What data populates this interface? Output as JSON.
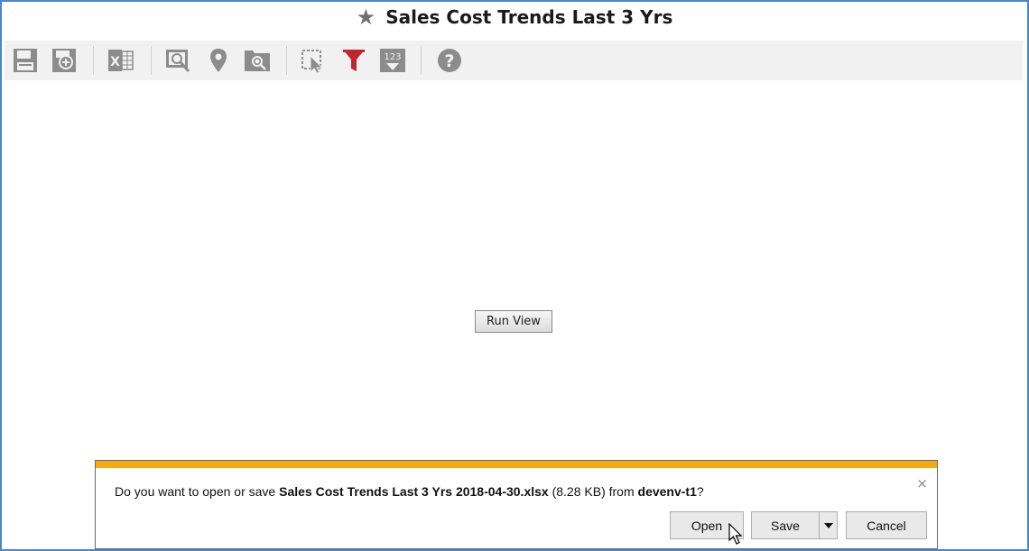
{
  "header": {
    "title": "Sales Cost Trends Last 3 Yrs",
    "favorite_icon": "star-icon"
  },
  "toolbar": {
    "items": [
      {
        "name": "save-icon"
      },
      {
        "name": "save-as-icon"
      },
      {
        "name": "export-excel-icon"
      },
      {
        "name": "analyze-icon"
      },
      {
        "name": "map-pin-icon"
      },
      {
        "name": "zoom-report-icon"
      },
      {
        "name": "select-cursor-icon"
      },
      {
        "name": "filter-icon",
        "color": "#c0262d"
      },
      {
        "name": "number-format-icon"
      },
      {
        "name": "help-icon"
      }
    ],
    "icon_color": "#8c8c8c"
  },
  "main": {
    "run_view_label": "Run View"
  },
  "download_bar": {
    "accent_color": "#f4a915",
    "msg_prefix": "Do you want to open or save ",
    "file_name": "Sales Cost Trends Last 3 Yrs 2018-04-30.xlsx",
    "file_size": "(8.28 KB)",
    "msg_from": " from ",
    "host": "devenv-t1",
    "msg_suffix": "?",
    "close_label": "×",
    "open_label": "Open",
    "save_label": "Save",
    "cancel_label": "Cancel"
  },
  "colors": {
    "frame_border": "#4a86c8",
    "toolbar_bg": "#f1f1f1"
  }
}
